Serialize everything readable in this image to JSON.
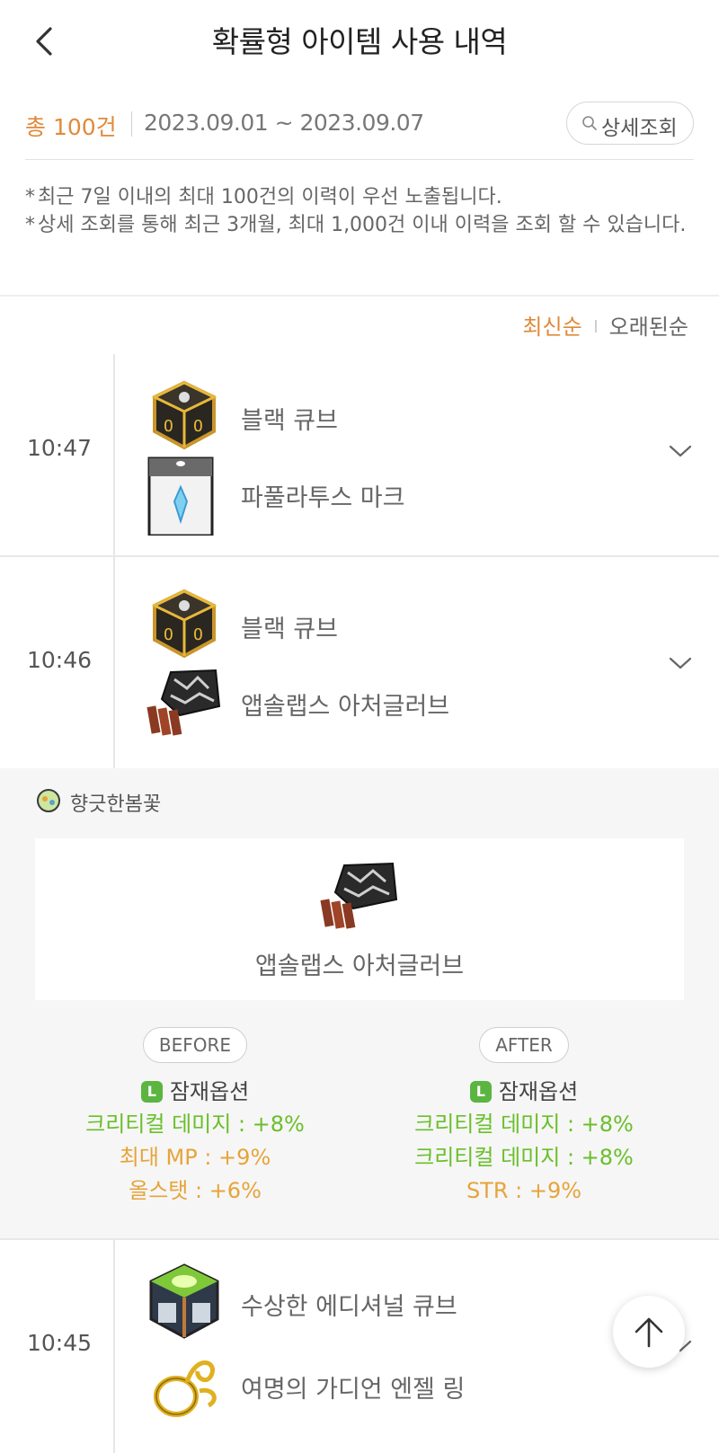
{
  "header": {
    "title": "확률형 아이템 사용 내역"
  },
  "summary": {
    "total": "총 100건",
    "range": "2023.09.01 ~ 2023.09.07",
    "detail_button": "상세조회"
  },
  "notes": [
    "최근 7일 이내의 최대 100건의 이력이 우선 노출됩니다.",
    "상세 조회를 통해 최근 3개월, 최대 1,000건 이내 이력을 조회 할 수 있습니다."
  ],
  "sort": {
    "newest": "최신순",
    "oldest": "오래된순"
  },
  "rows": [
    {
      "time": "10:47",
      "used_item": "블랙 큐브",
      "target_item": "파풀라투스 마크"
    },
    {
      "time": "10:46",
      "used_item": "블랙 큐브",
      "target_item": "앱솔랩스 아처글러브"
    },
    {
      "time": "10:45",
      "used_item": "수상한 에디셔널 큐브",
      "target_item": "여명의 가디언 엔젤 링"
    }
  ],
  "detail": {
    "character": "향긋한봄꽃",
    "item_name": "앱솔랩스 아처글러브",
    "before": {
      "label": "BEFORE",
      "potential_title": "잠재옵션",
      "potential_badge": "L",
      "options": [
        "크리티컬 데미지 : +8%",
        "최대 MP : +9%",
        "올스탯 : +6%"
      ]
    },
    "after": {
      "label": "AFTER",
      "potential_title": "잠재옵션",
      "potential_badge": "L",
      "options": [
        "크리티컬 데미지 : +8%",
        "크리티컬 데미지 : +8%",
        "STR : +9%"
      ]
    }
  },
  "colors": {
    "accent": "#e08a3a",
    "legendary_green": "#6abf2a",
    "unique_orange": "#e6a43a"
  }
}
